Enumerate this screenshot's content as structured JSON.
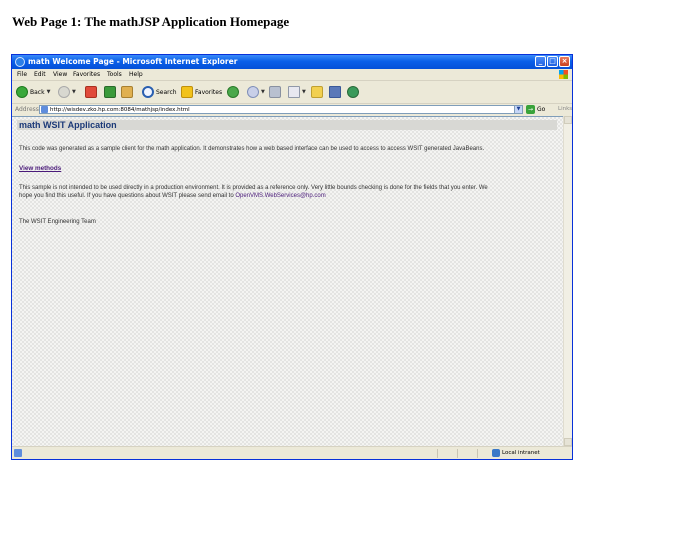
{
  "document": {
    "caption": "Web Page 1: The mathJSP Application Homepage"
  },
  "window": {
    "title": "math Welcome Page - Microsoft Internet Explorer"
  },
  "menu": [
    "File",
    "Edit",
    "View",
    "Favorites",
    "Tools",
    "Help"
  ],
  "toolbar": {
    "back": "Back",
    "search": "Search",
    "favorites": "Favorites"
  },
  "address": {
    "label": "Address",
    "url": "http://wisdev.zko.hp.com:8084/mathjsp/index.html",
    "go": "Go",
    "links": "Links"
  },
  "page": {
    "heading": "math WSIT Application",
    "intro": "This code was generated as a sample client for the math application. It demonstrates how a web based interface can be used to access to access WSIT generated JavaBeans.",
    "view_methods": "View methods",
    "disclaimer_1": "This sample is not intended to be used directly in a production environment. It is provided as a reference only. Very little bounds checking is done for the fields that you enter. We",
    "disclaimer_2": "hope you find this useful. If you have questions about WSIT please send email to",
    "email": "OpenVMS.WebServices@hp.com",
    "signature": "The WSIT Engineering Team"
  },
  "status": {
    "zone": "Local intranet"
  },
  "colors": {
    "titlebar": "#0a5fe8",
    "heading": "#1c3a78",
    "link": "#4a1a7a"
  }
}
